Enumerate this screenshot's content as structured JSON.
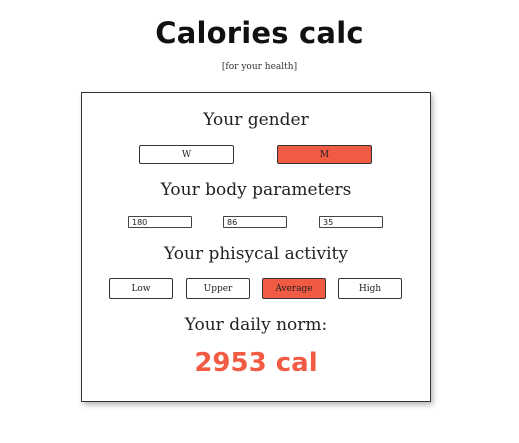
{
  "header": {
    "title": "Calories calc",
    "subtitle": "[for your health]"
  },
  "gender": {
    "heading": "Your gender",
    "options": [
      "W",
      "M"
    ],
    "selected": "M"
  },
  "body_parameters": {
    "heading": "Your body parameters",
    "values": [
      "180",
      "86",
      "35"
    ]
  },
  "activity": {
    "heading": "Your phisycal activity",
    "options": [
      "Low",
      "Upper",
      "Average",
      "High"
    ],
    "selected": "Average"
  },
  "result": {
    "heading": "Your daily norm:",
    "value": "2953 cal"
  },
  "colors": {
    "accent": "#f15a43"
  }
}
